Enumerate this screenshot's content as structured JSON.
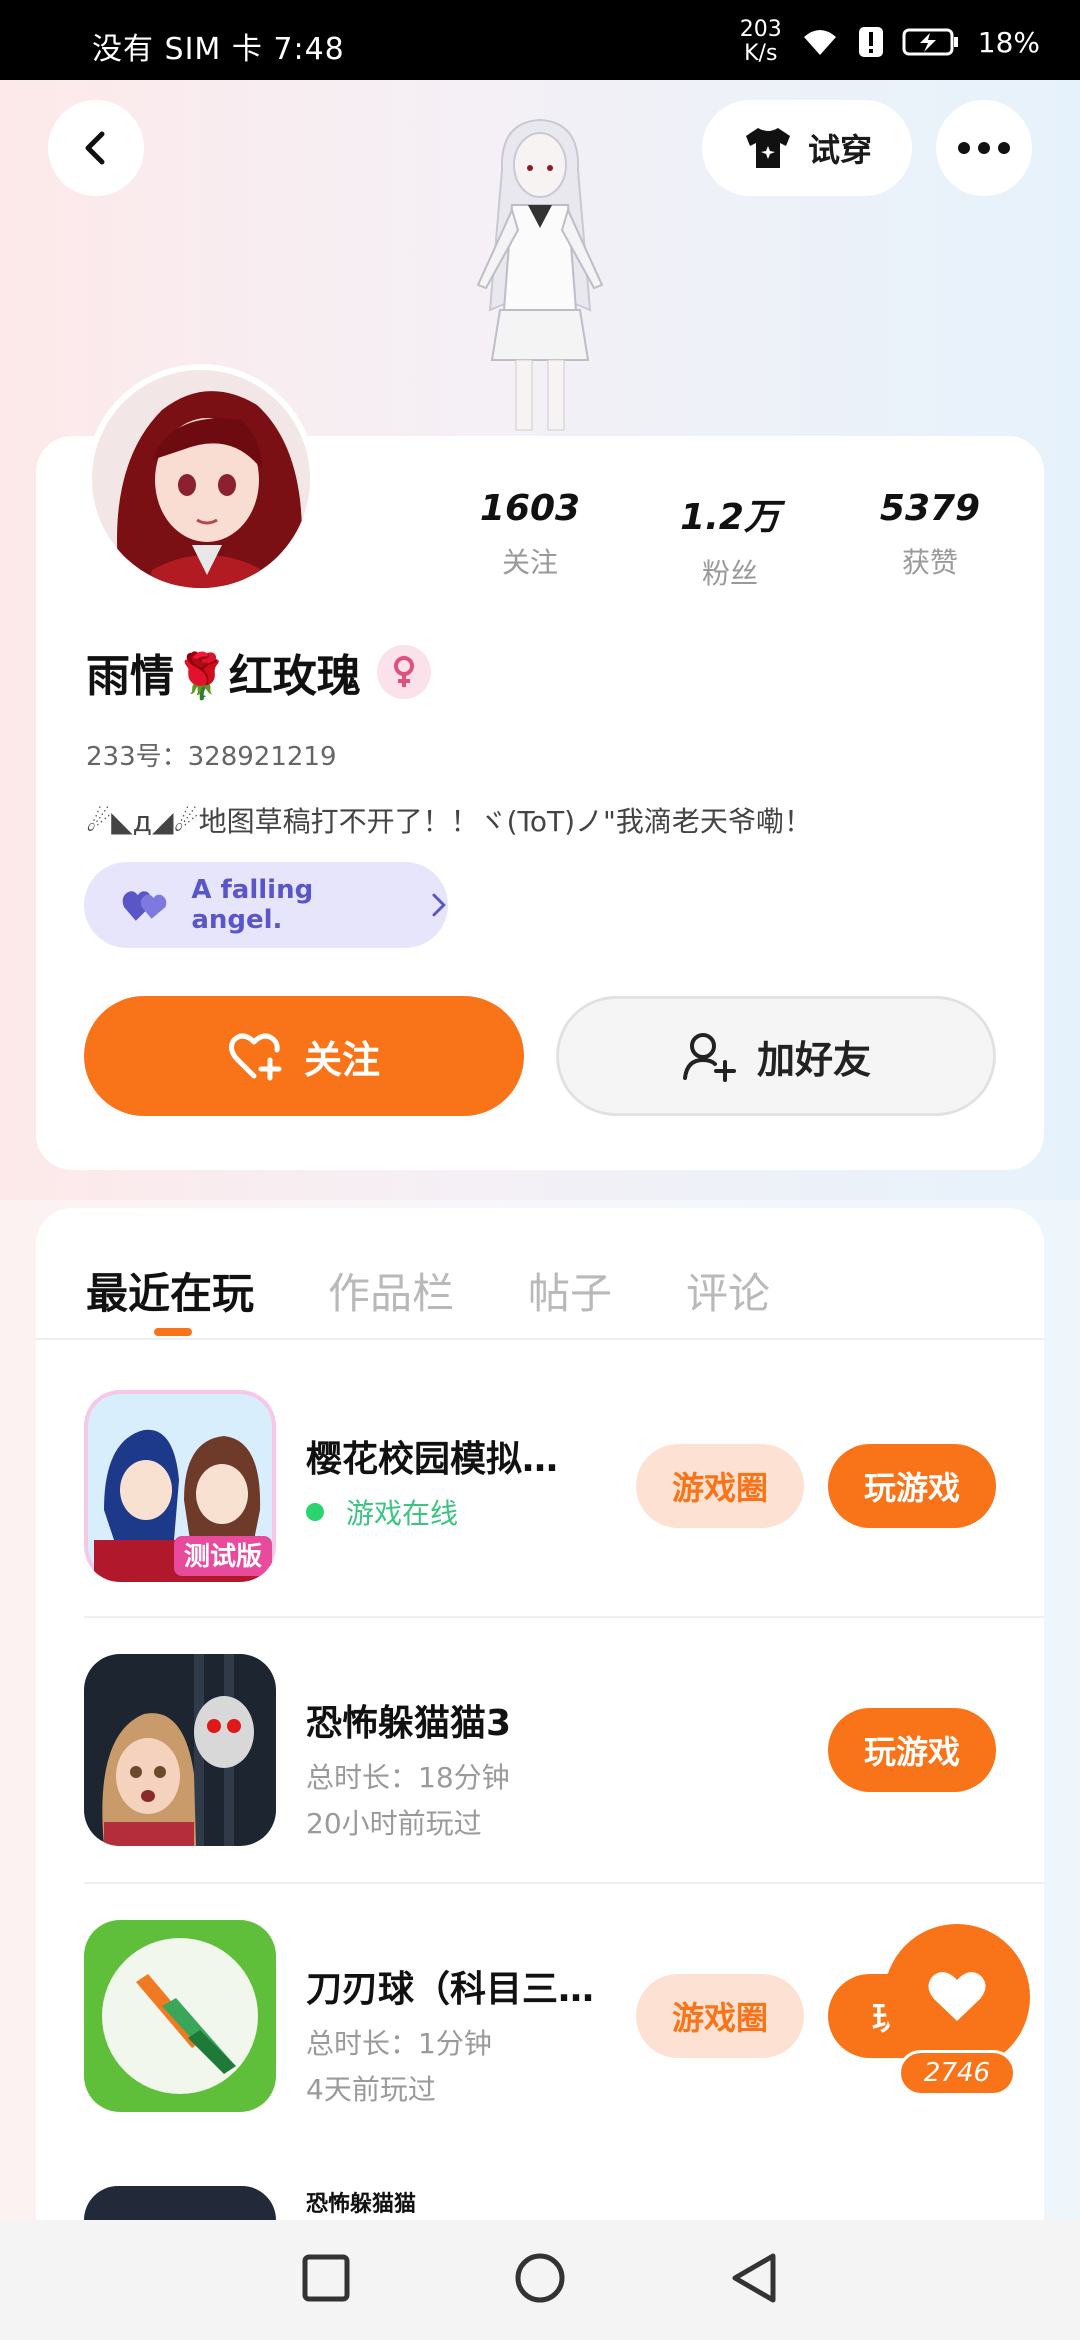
{
  "status_bar": {
    "carrier_time": "没有 SIM 卡 7:48",
    "net_speed_value": "203",
    "net_speed_unit": "K/s",
    "battery": "18%"
  },
  "header": {
    "try_on_label": "试穿"
  },
  "profile": {
    "stats": [
      {
        "num": "1603",
        "label": "关注"
      },
      {
        "num": "1.2万",
        "label": "粉丝"
      },
      {
        "num": "5379",
        "label": "获赞"
      }
    ],
    "name": "雨情🌹红玫瑰",
    "id_line": "233号：328921219",
    "bio": "☄◣д◢☄地图草稿打不开了！！ヾ(ToT)ノ\"我滴老天爷嘞！",
    "tag": "A falling angel.",
    "follow_label": "关注",
    "add_friend_label": "加好友"
  },
  "tabs": [
    "最近在玩",
    "作品栏",
    "帖子",
    "评论"
  ],
  "games": [
    {
      "title": "樱花校园模拟…",
      "status": "游戏在线",
      "circle_label": "游戏圈",
      "play_label": "玩游戏"
    },
    {
      "title": "恐怖躲猫猫3",
      "duration": "总时长：18分钟",
      "last_played": "20小时前玩过",
      "play_label": "玩游戏"
    },
    {
      "title": "刀刃球（科目三…",
      "duration": "总时长：1分钟",
      "last_played": "4天前玩过",
      "circle_label": "游戏圈",
      "play_label": "玩"
    },
    {
      "title": "恐怖躲猫猫"
    }
  ],
  "like_count": "2746",
  "colors": {
    "accent": "#f97418",
    "tag_purple": "#5a56c8"
  }
}
